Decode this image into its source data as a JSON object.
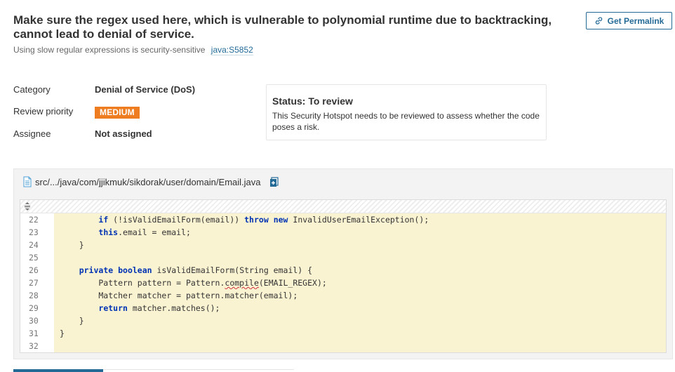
{
  "hotspot": {
    "title": "Make sure the regex used here, which is vulnerable to polynomial runtime due to backtracking, cannot lead to denial of service.",
    "subtitle": "Using slow regular expressions is security-sensitive",
    "rule_key": "java:S5852",
    "permalink_label": "Get Permalink"
  },
  "meta": {
    "category_label": "Category",
    "category_value": "Denial of Service (DoS)",
    "priority_label": "Review priority",
    "priority_value": "MEDIUM",
    "assignee_label": "Assignee",
    "assignee_value": "Not assigned"
  },
  "status": {
    "title": "Status: To review",
    "description": "This Security Hotspot needs to be reviewed to assess whether the code poses a risk."
  },
  "file": {
    "path": "src/.../java/com/jjikmuk/sikdorak/user/domain/Email.java"
  },
  "code_lines": [
    {
      "n": "22",
      "html": "        <span class=\"kw\">if</span> (!isValidEmailForm(email)) <span class=\"kw\">throw</span> <span class=\"kw\">new</span> InvalidUserEmailException();"
    },
    {
      "n": "23",
      "html": "        <span class=\"kw\">this</span>.email = email;"
    },
    {
      "n": "24",
      "html": "    }"
    },
    {
      "n": "25",
      "html": ""
    },
    {
      "n": "26",
      "html": "    <span class=\"kw\">private</span> <span class=\"kw\">boolean</span> isValidEmailForm(String email) {"
    },
    {
      "n": "27",
      "html": "        Pattern pattern = Pattern.<span class=\"squiggle\">compile</span>(EMAIL_REGEX);"
    },
    {
      "n": "28",
      "html": "        Matcher matcher = pattern.matcher(email);"
    },
    {
      "n": "29",
      "html": "        <span class=\"kw\">return</span> matcher.matches();"
    },
    {
      "n": "30",
      "html": "    }"
    },
    {
      "n": "31",
      "html": "}"
    },
    {
      "n": "32",
      "html": ""
    }
  ],
  "colors": {
    "accent": "#236a97",
    "priority_medium": "#ed7d20",
    "highlight": "#faf3d2"
  }
}
